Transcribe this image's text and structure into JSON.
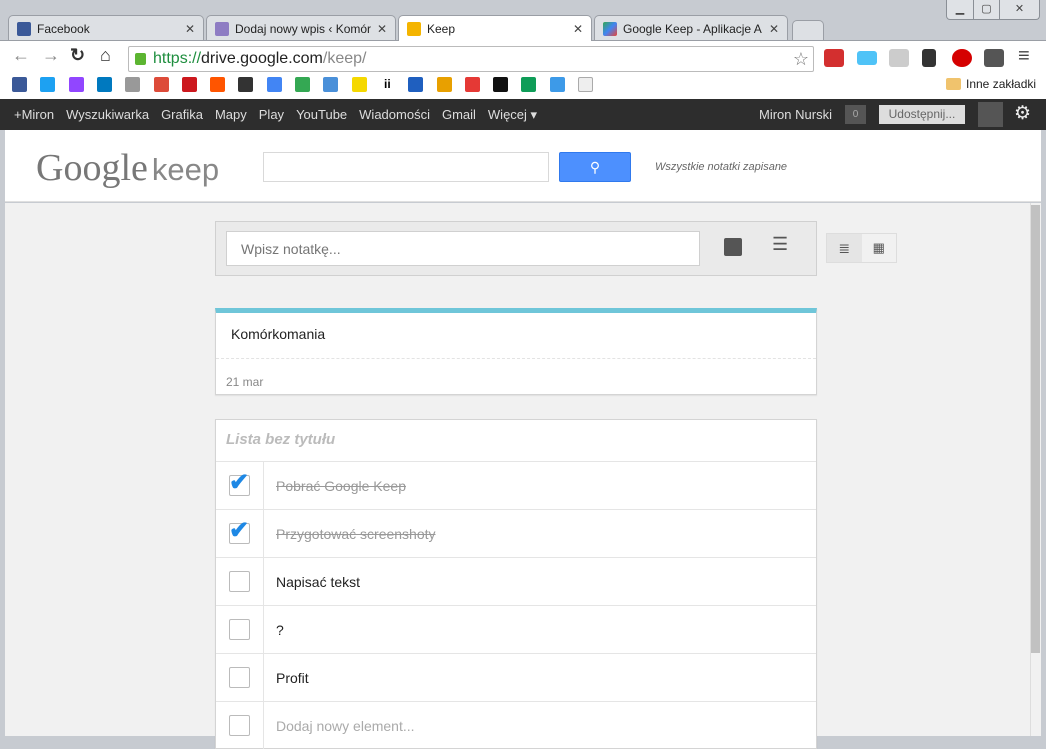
{
  "browser": {
    "tabs": [
      {
        "title": "Facebook",
        "color": "#3b5998"
      },
      {
        "title": "Dodaj nowy wpis ‹ Komór",
        "color": "#8e7cc3"
      },
      {
        "title": "Keep",
        "color": "#f4b400"
      },
      {
        "title": "Google Keep - Aplikacje A",
        "color": "#34a853"
      }
    ],
    "url_scheme": "https://",
    "url_host": "drive.google.com",
    "url_path": "/keep/",
    "other_bookmarks": "Inne zakładki",
    "bookmarks": [
      "facebook",
      "twitter",
      "twitch",
      "trello",
      "news",
      "google-plus",
      "youtube",
      "soundcloud",
      "film",
      "docs",
      "play",
      "wykop",
      "smiley",
      "ii",
      "star",
      "7u",
      "t",
      "info",
      "drive",
      "dropbox",
      "page"
    ],
    "bookmark_colors": [
      "#3b5998",
      "#1da1f2",
      "#9146ff",
      "#0079bf",
      "#999",
      "#dd4b39",
      "#cc181e",
      "#ff5500",
      "#333",
      "#4285f4",
      "#34a853",
      "#4a90d9",
      "#f5d800",
      "#fff",
      "#1f5fbf",
      "#e8a000",
      "#e53935",
      "#111",
      "#0f9d58",
      "#3d9ae8",
      "#eee"
    ],
    "bookmark_ii": "ii"
  },
  "gbar": {
    "links": [
      "+Miron",
      "Wyszukiwarka",
      "Grafika",
      "Mapy",
      "Play",
      "YouTube",
      "Wiadomości",
      "Gmail",
      "Więcej ▾"
    ],
    "user": "Miron Nurski",
    "count": "0",
    "share": "Udostępnij..."
  },
  "header": {
    "logo_google": "Google",
    "logo_keep": "keep",
    "status": "Wszystkie notatki zapisane"
  },
  "composer": {
    "placeholder": "Wpisz notatkę..."
  },
  "notes": [
    {
      "title": "Komórkomania",
      "date": "21 mar",
      "color": "#6fc6d9"
    }
  ],
  "list": {
    "title": "Lista bez tytułu",
    "items": [
      {
        "text": "Pobrać Google Keep",
        "checked": true
      },
      {
        "text": "Przygotować screenshoty",
        "checked": true
      },
      {
        "text": "Napisać tekst",
        "checked": false
      },
      {
        "text": "?",
        "checked": false
      },
      {
        "text": "Profit",
        "checked": false
      }
    ],
    "add_placeholder": "Dodaj nowy element..."
  }
}
